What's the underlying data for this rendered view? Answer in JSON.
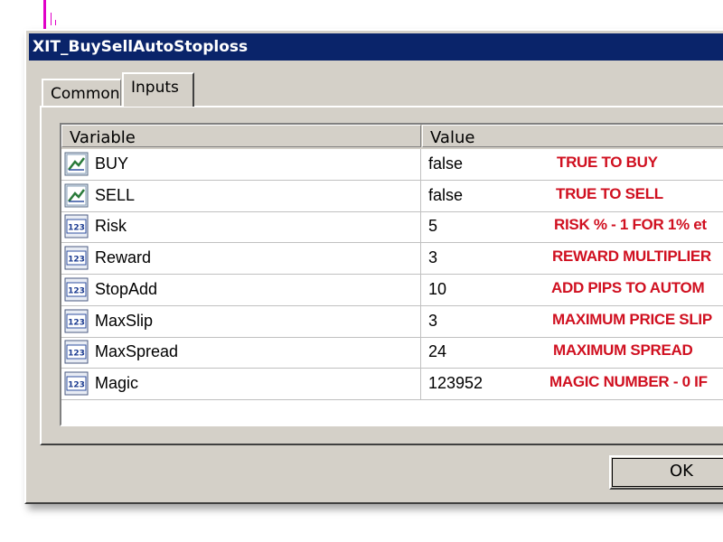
{
  "window": {
    "title": "XIT_BuySellAutoStoploss"
  },
  "tabs": [
    {
      "label": "Common",
      "selected": false
    },
    {
      "label": "Inputs",
      "selected": true
    }
  ],
  "table": {
    "columns": [
      "Variable",
      "Value"
    ],
    "rows": [
      {
        "icon": "bool-icon",
        "variable": "BUY",
        "value": "false",
        "note": "TRUE TO BUY"
      },
      {
        "icon": "bool-icon",
        "variable": "SELL",
        "value": "false",
        "note": "TRUE TO SELL"
      },
      {
        "icon": "number-icon",
        "variable": "Risk",
        "value": "5",
        "note": "RISK % - 1 FOR 1% et"
      },
      {
        "icon": "number-icon",
        "variable": "Reward",
        "value": "3",
        "note": "REWARD MULTIPLIER"
      },
      {
        "icon": "number-icon",
        "variable": "StopAdd",
        "value": "10",
        "note": "ADD PIPS TO AUTOM"
      },
      {
        "icon": "number-icon",
        "variable": "MaxSlip",
        "value": "3",
        "note": "MAXIMUM PRICE SLIP"
      },
      {
        "icon": "number-icon",
        "variable": "MaxSpread",
        "value": "24",
        "note": "MAXIMUM SPREAD"
      },
      {
        "icon": "number-icon",
        "variable": "Magic",
        "value": "123952",
        "note": "MAGIC NUMBER - 0 IF"
      }
    ]
  },
  "buttons": {
    "ok_label": "OK"
  },
  "colors": {
    "titlebar": "#0a246a",
    "note_text": "#d01020",
    "dialog_face": "#d4d0c8"
  }
}
